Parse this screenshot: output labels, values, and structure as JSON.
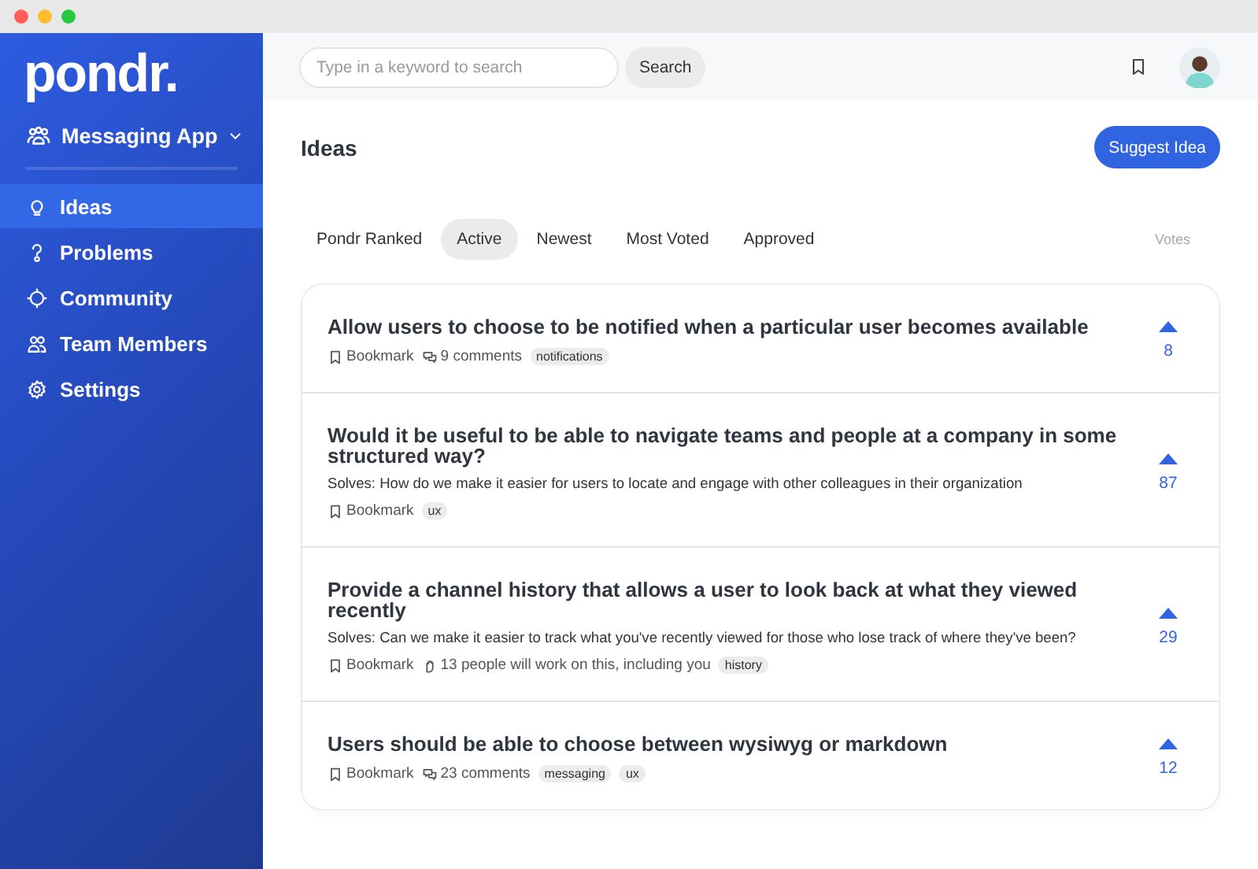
{
  "sidebar": {
    "logo": "pondr.",
    "workspace": "Messaging App",
    "items": [
      {
        "label": "Ideas",
        "selected": true
      },
      {
        "label": "Problems",
        "selected": false
      },
      {
        "label": "Community",
        "selected": false
      },
      {
        "label": "Team Members",
        "selected": false
      },
      {
        "label": "Settings",
        "selected": false
      }
    ]
  },
  "topbar": {
    "search": {
      "placeholder": "Type in a keyword to search"
    },
    "search_button": "Search"
  },
  "page": {
    "title": "Ideas",
    "action": "Suggest Idea",
    "tabs": [
      {
        "label": "Pondr Ranked",
        "selected": false
      },
      {
        "label": "Active",
        "selected": true
      },
      {
        "label": "Newest",
        "selected": false
      },
      {
        "label": "Most Voted",
        "selected": false
      },
      {
        "label": "Approved",
        "selected": false
      }
    ],
    "votes_heading": "Votes",
    "ideas": [
      {
        "title": "Allow users to choose to be notified when a particular user becomes available",
        "bookmark": "Bookmark",
        "meta": [
          {
            "kind": "comments",
            "text": "9 comments"
          }
        ],
        "tags": [
          "notifications"
        ],
        "votes": "8"
      },
      {
        "title": "Would it be useful to be able to navigate teams and people at a company in some structured way?",
        "solves": "Solves: How do we make it easier for users to locate and engage with other colleagues in their organization",
        "bookmark": "Bookmark",
        "tags": [
          "ux"
        ],
        "votes": "87"
      },
      {
        "title": "Provide a channel history that allows a user to look back at what they viewed recently",
        "solves": "Solves: Can we make it easier to track what you've recently viewed for those who lose track of where they've been?",
        "bookmark": "Bookmark",
        "meta": [
          {
            "kind": "people",
            "text": "13 people will work on this, including you"
          }
        ],
        "tags": [
          "history"
        ],
        "votes": "29"
      },
      {
        "title": "Users should be able to choose between wysiwyg or markdown",
        "bookmark": "Bookmark",
        "meta": [
          {
            "kind": "comments",
            "text": "23 comments"
          }
        ],
        "tags": [
          "messaging",
          "ux"
        ],
        "votes": "12"
      }
    ]
  }
}
